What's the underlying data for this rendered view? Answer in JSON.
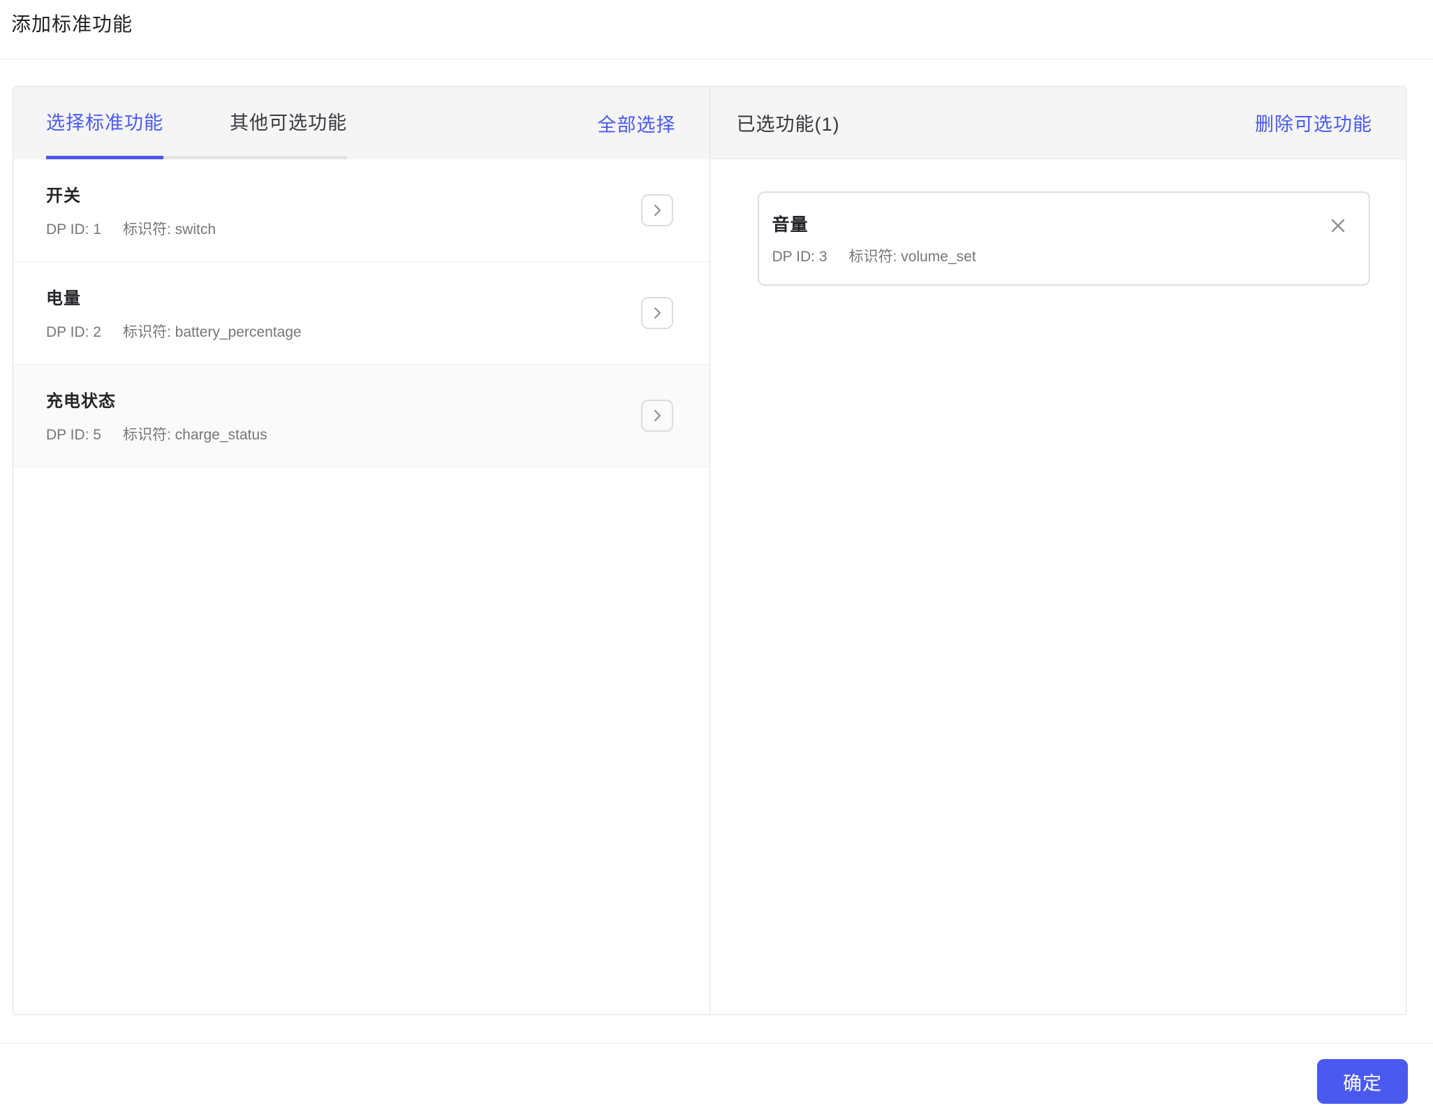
{
  "page": {
    "title": "添加标准功能"
  },
  "colors": {
    "accent": "#4a5af1",
    "header_band": "#f5f5f6",
    "panel_border": "#dfe0e3"
  },
  "left_panel": {
    "tabs": [
      {
        "label": "选择标准功能",
        "active": true
      },
      {
        "label": "其他可选功能",
        "active": false
      }
    ],
    "select_all_label": "全部选择",
    "items": [
      {
        "name": "开关",
        "dp_id": "DP ID: 1",
        "identifier": "标识符: switch"
      },
      {
        "name": "电量",
        "dp_id": "DP ID: 2",
        "identifier": "标识符: battery_percentage"
      },
      {
        "name": "充电状态",
        "dp_id": "DP ID: 5",
        "identifier": "标识符: charge_status"
      }
    ],
    "row_action_icon": "chevron-right-icon"
  },
  "right_panel": {
    "title": "已选功能(1)",
    "delete_link_label": "删除可选功能",
    "selected_items": [
      {
        "name": "音量",
        "dp_id": "DP ID: 3",
        "identifier": "标识符: volume_set"
      }
    ],
    "remove_icon": "close-icon"
  },
  "footer": {
    "confirm_label": "确定"
  }
}
